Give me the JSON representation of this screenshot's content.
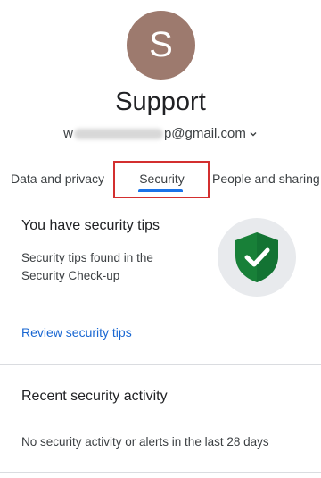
{
  "account": {
    "avatar_letter": "S",
    "name": "Support",
    "email_prefix": "w",
    "email_suffix": "p@gmail.com"
  },
  "tabs": [
    {
      "label": "Data and privacy",
      "selected": false
    },
    {
      "label": "Security",
      "selected": true
    },
    {
      "label": "People and sharing",
      "selected": false
    }
  ],
  "security_tips": {
    "title": "You have security tips",
    "description": "Security tips found in the Security Check-up",
    "link_label": "Review security tips",
    "icon": "shield-check-icon"
  },
  "recent_activity": {
    "title": "Recent security activity",
    "description": "No security activity or alerts in the last 28 days"
  },
  "colors": {
    "avatar_bg": "#9d7a6e",
    "accent": "#1a73e8",
    "shield_green": "#188038",
    "highlight": "#d32f2f"
  }
}
